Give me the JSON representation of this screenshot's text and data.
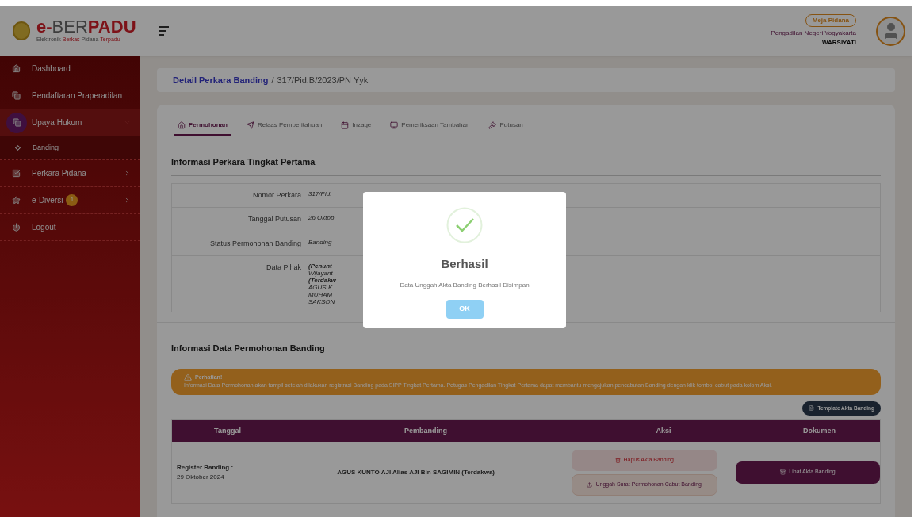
{
  "header": {
    "logo_parts": [
      {
        "text": "e-",
        "kind": "accent"
      },
      {
        "text": "BER",
        "kind": "plain"
      },
      {
        "text": "PADU",
        "kind": "accent"
      }
    ],
    "tagline_parts": [
      {
        "text": "Elektronik",
        "kind": "plain"
      },
      {
        "text": "Berkas",
        "kind": "accent"
      },
      {
        "text": "Pidana",
        "kind": "plain"
      },
      {
        "text": "Terpadu",
        "kind": "accent"
      }
    ],
    "role_badge": "Meja Pidana",
    "court": "Pengadilan Negeri Yogyakarta",
    "user": "WARSIYATI"
  },
  "sidebar": {
    "items": [
      {
        "label": "Dashboard",
        "selected": false
      },
      {
        "label": "Pendaftaran Praperadilan",
        "selected": false
      },
      {
        "label": "Upaya Hukum",
        "selected": true,
        "expanded": true,
        "children": [
          {
            "label": "Banding"
          }
        ]
      },
      {
        "label": "Perkara Pidana",
        "selected": false,
        "expanded": false
      },
      {
        "label": "e-Diversi",
        "selected": false,
        "expanded": false,
        "badge": "1"
      },
      {
        "label": "Logout",
        "selected": false
      }
    ]
  },
  "breadcrumb": {
    "parent": "Detail Perkara Banding",
    "separator": "/",
    "current": "317/Pid.B/2023/PN Yyk"
  },
  "tabs": [
    {
      "label": "Permohonan",
      "selected": true
    },
    {
      "label": "Relaas Pemberitahuan",
      "selected": false
    },
    {
      "label": "Inzage",
      "selected": false
    },
    {
      "label": "Pemeriksaan Tambahan",
      "selected": false
    },
    {
      "label": "Putusan",
      "selected": false
    }
  ],
  "first_instance": {
    "title": "Informasi Perkara Tingkat Pertama",
    "rows": [
      {
        "label": "Nomor Perkara",
        "lines": [
          {
            "text": "317/Pid.",
            "kind": "name"
          }
        ]
      },
      {
        "label": "Tanggal Putusan",
        "lines": [
          {
            "text": "26 Oktob",
            "kind": "name"
          }
        ]
      },
      {
        "label": "Status Permohonan Banding",
        "lines": [
          {
            "text": "Banding",
            "kind": "name"
          }
        ]
      },
      {
        "label": "Data Pihak",
        "lines": [
          {
            "text": "(Penunt",
            "kind": "role"
          },
          {
            "text": "Wijayant",
            "kind": "name"
          },
          {
            "text": "(Terdakw",
            "kind": "role"
          },
          {
            "text": "AGUS K",
            "kind": "name"
          },
          {
            "text": "MUHAM",
            "kind": "name"
          },
          {
            "text": "SAKSON",
            "kind": "name"
          }
        ]
      }
    ]
  },
  "appeal": {
    "title": "Informasi Data Permohonan Banding",
    "alert": {
      "title": "Perhatian!",
      "text": "Informasi Data Permohonan akan tampil setelah dilakukan registrasi Banding pada SIPP Tingkat Pertama. Petugas Pengadilan Tingkat Pertama dapat membantu mengajukan pencabutan Banding dengan klik tombol cabut pada kolom Aksi."
    },
    "template_button": "Template Akta Banding",
    "table": {
      "columns": [
        "Tanggal",
        "Pembanding",
        "Aksi",
        "Dokumen"
      ],
      "rows": [
        {
          "date_label": "Register Banding :",
          "date": "29 Oktober 2024",
          "appellant": "AGUS KUNTO AJI Alias AJI Bin SAGIMIN (Terdakwa)",
          "actions": [
            {
              "label": "Hapus Akta Banding",
              "kind": "delete"
            },
            {
              "label": "Unggah Surat Permohonan Cabut Banding",
              "kind": "upload"
            }
          ],
          "document": "Lihat Akta Banding"
        }
      ]
    }
  },
  "dialog": {
    "title": "Berhasil",
    "message": "Data Unggah Akta Banding Berhasil Disimpan",
    "button": "OK"
  }
}
